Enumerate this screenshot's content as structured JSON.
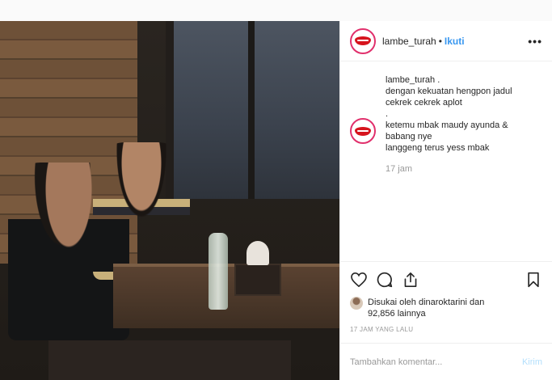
{
  "header": {
    "username": "lambe_turah",
    "separator": "•",
    "follow_label": "Ikuti",
    "more_icon": "more-options-icon"
  },
  "caption": {
    "username": "lambe_turah",
    "lines": [
      "lambe_turah .",
      "dengan kekuatan hengpon jadul",
      "cekrek cekrek aplot",
      ".",
      "ketemu mbak maudy ayunda &",
      "babang nye",
      "langgeng terus yess mbak"
    ],
    "time": "17 jam"
  },
  "actions": {
    "like_icon": "heart-icon",
    "comment_icon": "comment-icon",
    "share_icon": "share-icon",
    "save_icon": "bookmark-icon"
  },
  "likes": {
    "line1": "Disukai oleh dinaroktarini dan",
    "line2": "92,856 lainnya"
  },
  "timestamp": "17 JAM YANG LALU",
  "comment_box": {
    "placeholder": "Tambahkan komentar...",
    "send_label": "Kirim"
  },
  "colors": {
    "accent": "#3897f0",
    "send_disabled": "#b2dffc",
    "brand_lips": "#d6141d"
  }
}
